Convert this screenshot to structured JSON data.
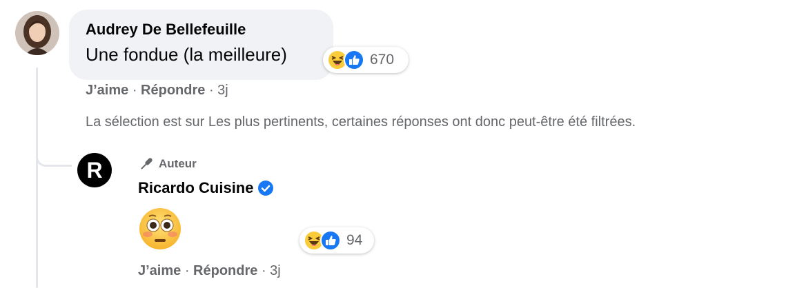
{
  "comment": {
    "author": "Audrey De Bellefeuille",
    "text": "Une fondue (la meilleure)",
    "reactions": {
      "icons": [
        "haha-icon",
        "like-icon"
      ],
      "count": "670"
    },
    "actions": {
      "like": "J’aime",
      "separator": " · ",
      "reply": "Répondre",
      "time": "3j"
    }
  },
  "notice": "La sélection est sur Les plus pertinents, certaines réponses ont donc peut-être été filtrées.",
  "reply": {
    "avatar_letter": "R",
    "badge": "Auteur",
    "author": "Ricardo Cuisine",
    "verified": true,
    "content_emoji": "flushed-face",
    "reactions": {
      "icons": [
        "haha-icon",
        "like-icon"
      ],
      "count": "94"
    },
    "actions": {
      "like": "J’aime",
      "separator": " · ",
      "reply": "Répondre",
      "time": "3j"
    }
  },
  "colors": {
    "like_blue": "#1877f2",
    "secondary_text": "#65676b",
    "bubble_bg": "#f0f2f5",
    "emoji_yellow": "#fbcc3a"
  }
}
